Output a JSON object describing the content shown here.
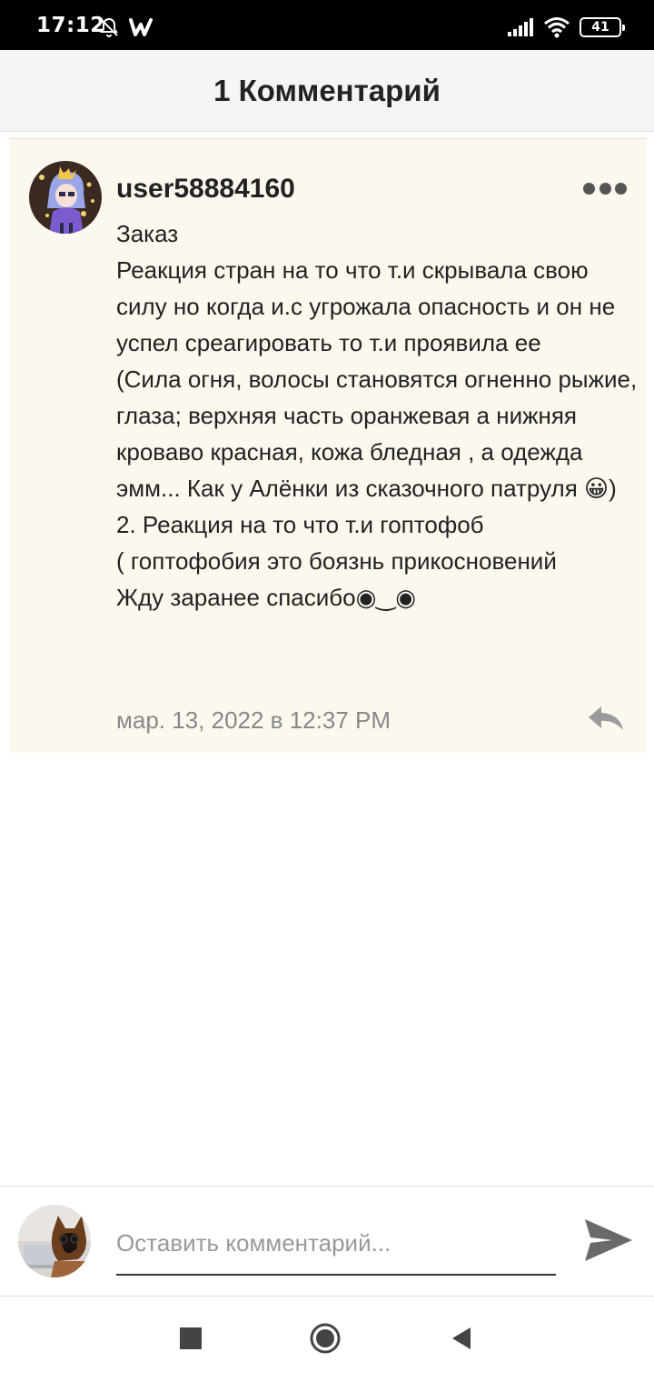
{
  "status_bar": {
    "time": "17:12",
    "battery": "41",
    "icons": [
      "mute-alarm-icon",
      "wattpad-icon",
      "signal-icon",
      "wifi-icon",
      "battery-icon"
    ]
  },
  "header": {
    "title": "1 Комментарий"
  },
  "comment": {
    "username": "user58884160",
    "body": "Заказ\nРеакция стран на то что т.и скрывала свою силу но когда и.с угрожала опасность и он не успел среагировать то т.и проявила ее\n(Сила огня, волосы становятся огненно рыжие, глаза; верхняя часть оранжевая а нижняя кроваво красная, кожа бледная , а одежда эмм... Как у Алёнки из сказочного патруля 😀)\n2. Реакция на то что т.и гоптофоб\n( гоптофобия это боязнь прикосновений\nЖду заранее спасибо◉‿◉",
    "timestamp": "мар. 13, 2022 в 12:37 PM",
    "icons": [
      "more-icon",
      "reply-icon"
    ]
  },
  "composer": {
    "placeholder": "Оставить комментарий...",
    "value": "",
    "icons": [
      "send-icon"
    ]
  },
  "nav_bar": {
    "icons": [
      "recents-icon",
      "home-icon",
      "back-icon"
    ]
  },
  "colors": {
    "card_background": "#fdf8ef",
    "header_background": "#f5f5f5",
    "status_bar": "#000000",
    "timestamp": "#888888"
  }
}
